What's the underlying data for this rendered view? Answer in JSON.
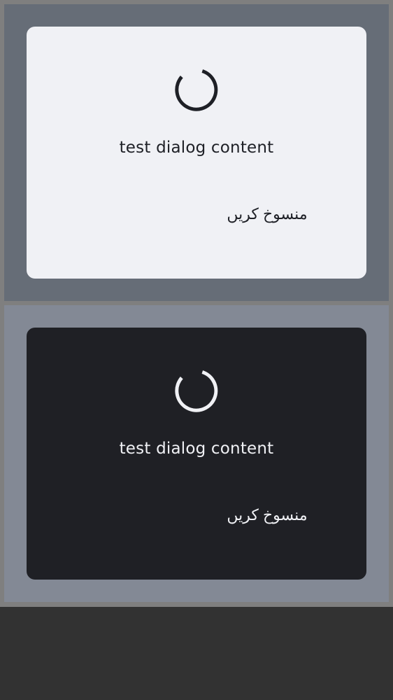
{
  "dialogs": [
    {
      "theme": "light",
      "icon": "loading-spinner-icon",
      "content": "test dialog content",
      "cancel_label": "منسوخ کریں"
    },
    {
      "theme": "dark",
      "icon": "loading-spinner-icon",
      "content": "test dialog content",
      "cancel_label": "منسوخ کریں"
    }
  ],
  "colors": {
    "outer_background": "#7f7f7f",
    "light_scrim": "#666d77",
    "light_dialog": "#f0f1f5",
    "dark_scrim": "#838995",
    "dark_dialog": "#1f2025",
    "bottom_bar": "#323232"
  }
}
